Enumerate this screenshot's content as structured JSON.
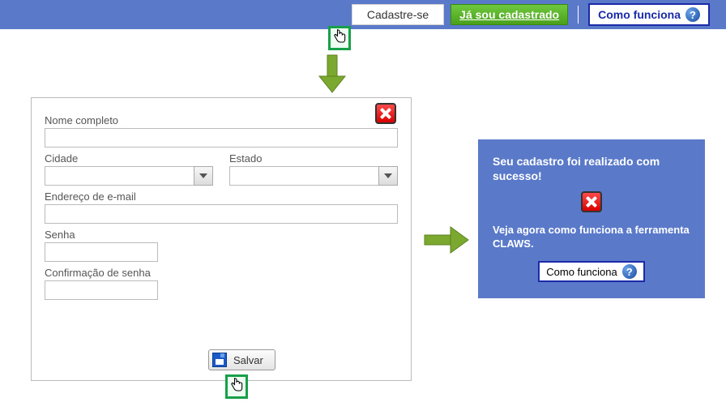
{
  "topbar": {
    "cadastre": "Cadastre-se",
    "ja_cadastrado": "Já sou cadastrado",
    "como_funciona": "Como funciona"
  },
  "form": {
    "nome_label": "Nome completo",
    "nome_value": "",
    "cidade_label": "Cidade",
    "cidade_value": "",
    "estado_label": "Estado",
    "estado_value": "",
    "email_label": "Endereço de e-mail",
    "email_value": "",
    "senha_label": "Senha",
    "senha_value": "",
    "conf_label": "Confirmação de senha",
    "conf_value": "",
    "salvar_label": "Salvar"
  },
  "success": {
    "title": "Seu cadastro foi realizado com sucesso!",
    "subtitle": "Veja agora como funciona a ferramenta CLAWS.",
    "como_funciona": "Como funciona"
  },
  "icons": {
    "help": "?",
    "close": "×"
  }
}
